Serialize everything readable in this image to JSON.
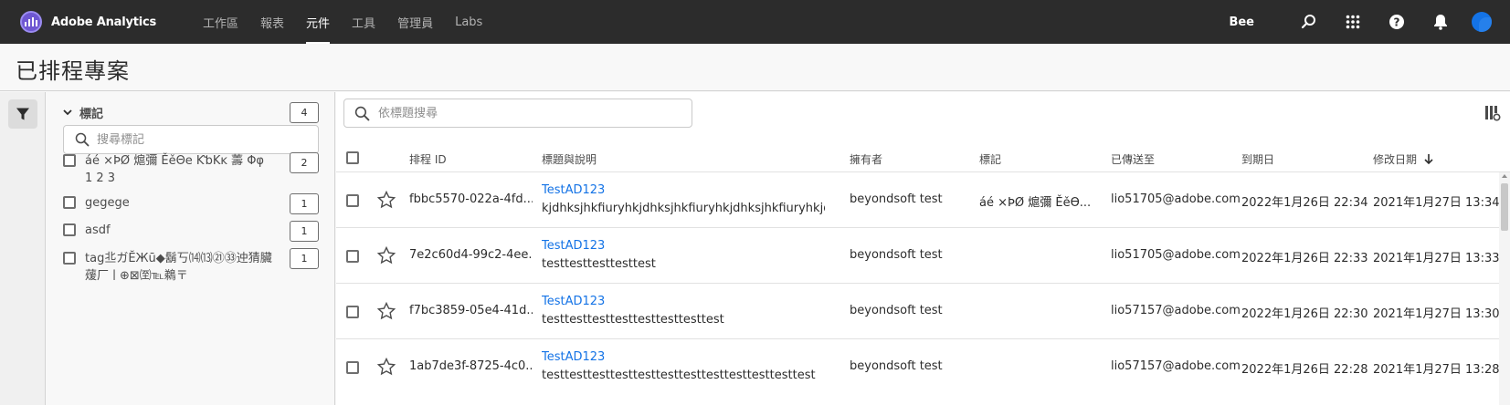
{
  "app": {
    "name": "Adobe Analytics"
  },
  "nav": {
    "items": [
      {
        "label": "工作區",
        "active": false
      },
      {
        "label": "報表",
        "active": false
      },
      {
        "label": "元件",
        "active": true
      },
      {
        "label": "工具",
        "active": false
      },
      {
        "label": "管理員",
        "active": false
      },
      {
        "label": "Labs",
        "active": false
      }
    ],
    "org_name": "Bee",
    "icons": [
      "search-icon",
      "apps-grid-icon",
      "help-icon",
      "bell-icon",
      "avatar"
    ]
  },
  "page": {
    "title": "已排程專案"
  },
  "filters": {
    "section_label": "標記",
    "section_count": "4",
    "search_placeholder": "搜尋標記",
    "tags": [
      {
        "label": "áé ×ÞØ 熩彌 ĚěΘe ƘƅKĸ 薵 Φφ 1 2 3",
        "count": "2"
      },
      {
        "label": "gegege",
        "count": "1"
      },
      {
        "label": "asdf",
        "count": "1"
      },
      {
        "label": "tag丠ガĔЖū◆鬍丂⒁⒀㉑㉝迚猜臟蕿厂ㅣ⊕⊠㉃℡鵜〒",
        "count": "1"
      }
    ]
  },
  "list": {
    "search_placeholder": "依標題搜尋",
    "columns": {
      "id": "排程 ID",
      "title": "標題與說明",
      "owner": "擁有者",
      "tags": "標記",
      "sent_to": "已傳送至",
      "expires": "到期日",
      "modified": "修改日期"
    },
    "rows": [
      {
        "id": "fbbc5570-022a-4fd...",
        "title": "TestAD123",
        "description": "kjdhksjhkfiuryhkjdhksjhkfiuryhkjdhksjhkfiuryhkjdhks...",
        "owner": "beyondsoft test",
        "tags": "áé ×ÞØ 熩彌 Ěěϴ...",
        "sent_to": "lio51705@adobe.com",
        "expires": "2022年1月26日 22:34",
        "modified": "2021年1月27日 13:34"
      },
      {
        "id": "7e2c60d4-99c2-4ee...",
        "title": "TestAD123",
        "description": "testtesttesttesttest",
        "owner": "beyondsoft test",
        "tags": "",
        "sent_to": "lio51705@adobe.com",
        "expires": "2022年1月26日 22:33",
        "modified": "2021年1月27日 13:33"
      },
      {
        "id": "f7bc3859-05e4-41d...",
        "title": "TestAD123",
        "description": "testtesttesttesttesttesttesttest",
        "owner": "beyondsoft test",
        "tags": "",
        "sent_to": "lio57157@adobe.com",
        "expires": "2022年1月26日 22:30",
        "modified": "2021年1月27日 13:30"
      },
      {
        "id": "1ab7de3f-8725-4c0...",
        "title": "TestAD123",
        "description": "testtesttesttesttesttesttesttesttesttesttesttest",
        "owner": "beyondsoft test",
        "tags": "",
        "sent_to": "lio57157@adobe.com",
        "expires": "2022年1月26日 22:28",
        "modified": "2021年1月27日 13:28"
      }
    ]
  }
}
